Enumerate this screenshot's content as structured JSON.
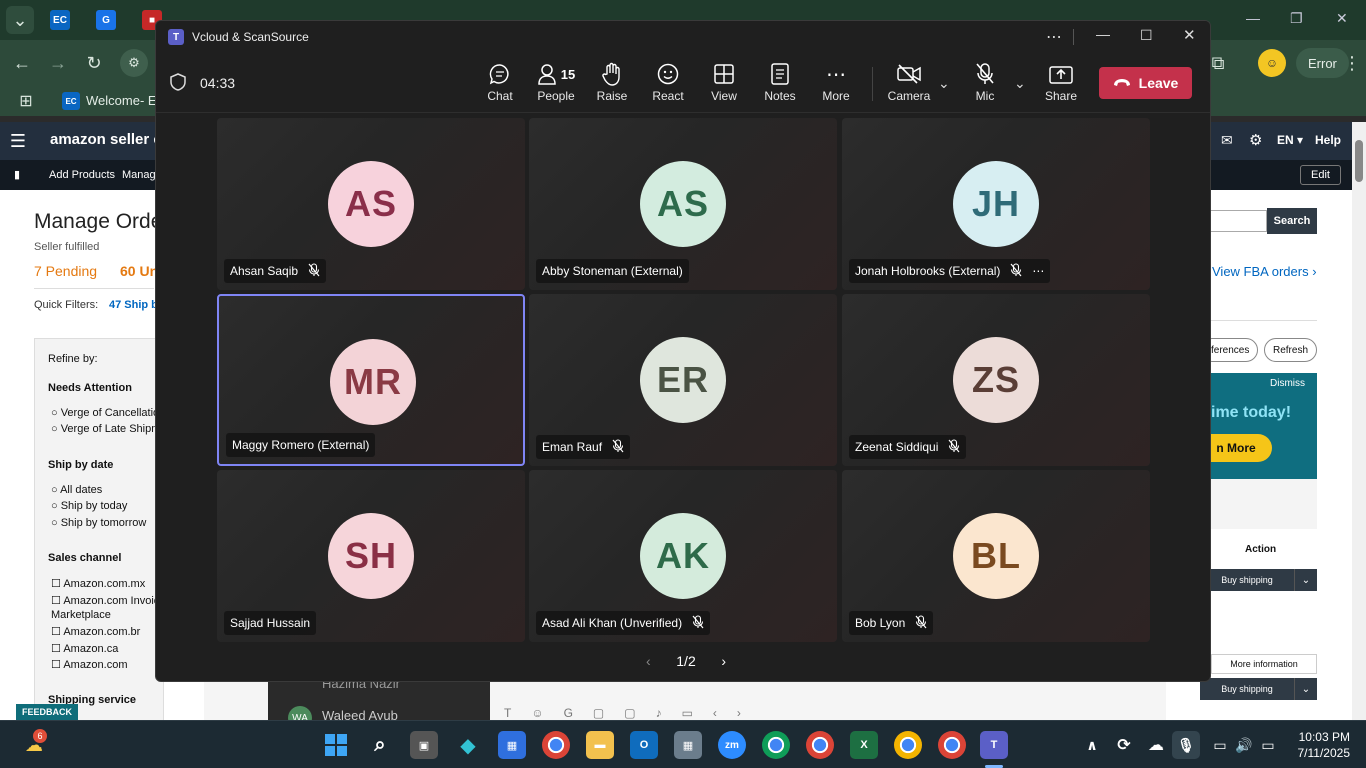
{
  "browser": {
    "tab_label": "Welcome- EC",
    "profile_status": "Error"
  },
  "amazon": {
    "logo": "amazon seller cent",
    "lang": "EN",
    "help": "Help",
    "edit": "Edit",
    "subnav": [
      "Add Products",
      "Manage"
    ],
    "page_title": "Manage Orde",
    "seller_fulfilled": "Seller fulfilled",
    "pending": "7 Pending",
    "unshipped": "60 Un",
    "quick_filters_label": "Quick Filters:",
    "quick_filter_value": "47 Ship b",
    "search_btn": "Search",
    "view_fba": "View FBA orders ›",
    "preferences": "ferences",
    "refresh": "Refresh",
    "dismiss": "Dismiss",
    "promo_line": "ime today!",
    "promo_btn": "n More",
    "action_header": "Action",
    "buy_shipping": "Buy shipping",
    "more_info": "More information",
    "refine_by": "Refine by:",
    "needs_attention": "Needs Attention",
    "needs_items": [
      "Verge of Cancellatio",
      "Verge of Late Shipm"
    ],
    "ship_by_date": "Ship by date",
    "ship_items": [
      "All dates",
      "Ship by today",
      "Ship by tomorrow"
    ],
    "sales_channel": "Sales channel",
    "channel_items": [
      "Amazon.com.mx",
      "Amazon.com Invoic",
      "Marketplace",
      "Amazon.com.br",
      "Amazon.ca",
      "Amazon.com"
    ],
    "shipping_service": "Shipping service",
    "feedback": "FEEDBACK"
  },
  "teams": {
    "window_title": "Vcloud & ScanSource",
    "timer": "04:33",
    "toolbar": {
      "chat": "Chat",
      "people": "People",
      "people_count": "15",
      "raise": "Raise",
      "react": "React",
      "view": "View",
      "notes": "Notes",
      "more": "More",
      "camera": "Camera",
      "mic": "Mic",
      "share": "Share",
      "leave": "Leave"
    },
    "participants": [
      {
        "initials": "AS",
        "name": "Ahsan Saqib",
        "muted": true,
        "bg": "#f7d2dc",
        "fg": "#8a2f4a"
      },
      {
        "initials": "AS",
        "name": "Abby Stoneman (External)",
        "muted": false,
        "bg": "#d3ecdf",
        "fg": "#2e6b4c"
      },
      {
        "initials": "JH",
        "name": "Jonah Holbrooks (External)",
        "muted": true,
        "bg": "#d7eef2",
        "fg": "#2f6b78"
      },
      {
        "initials": "MR",
        "name": "Maggy Romero (External)",
        "muted": false,
        "bg": "#f3d3d7",
        "fg": "#8a3a44"
      },
      {
        "initials": "ER",
        "name": "Eman Rauf",
        "muted": true,
        "bg": "#dfe6dd",
        "fg": "#4a5344"
      },
      {
        "initials": "ZS",
        "name": "Zeenat Siddiqui",
        "muted": true,
        "bg": "#ecdcd8",
        "fg": "#5a3e36"
      },
      {
        "initials": "SH",
        "name": "Sajjad Hussain",
        "muted": false,
        "bg": "#f6d5da",
        "fg": "#8a2f45"
      },
      {
        "initials": "AK",
        "name": "Asad Ali Khan (Unverified)",
        "muted": true,
        "bg": "#d4ebdc",
        "fg": "#2e6b4a"
      },
      {
        "initials": "BL",
        "name": "Bob Lyon",
        "muted": true,
        "bg": "#fbe6cf",
        "fg": "#7a4a20"
      }
    ],
    "pager": "1/2",
    "chat_behind_names": [
      "Hazima Nazir",
      "Waleed Ayub"
    ]
  },
  "taskbar": {
    "weather_badge": "6",
    "time": "10:03 PM",
    "date": "7/11/2025"
  }
}
